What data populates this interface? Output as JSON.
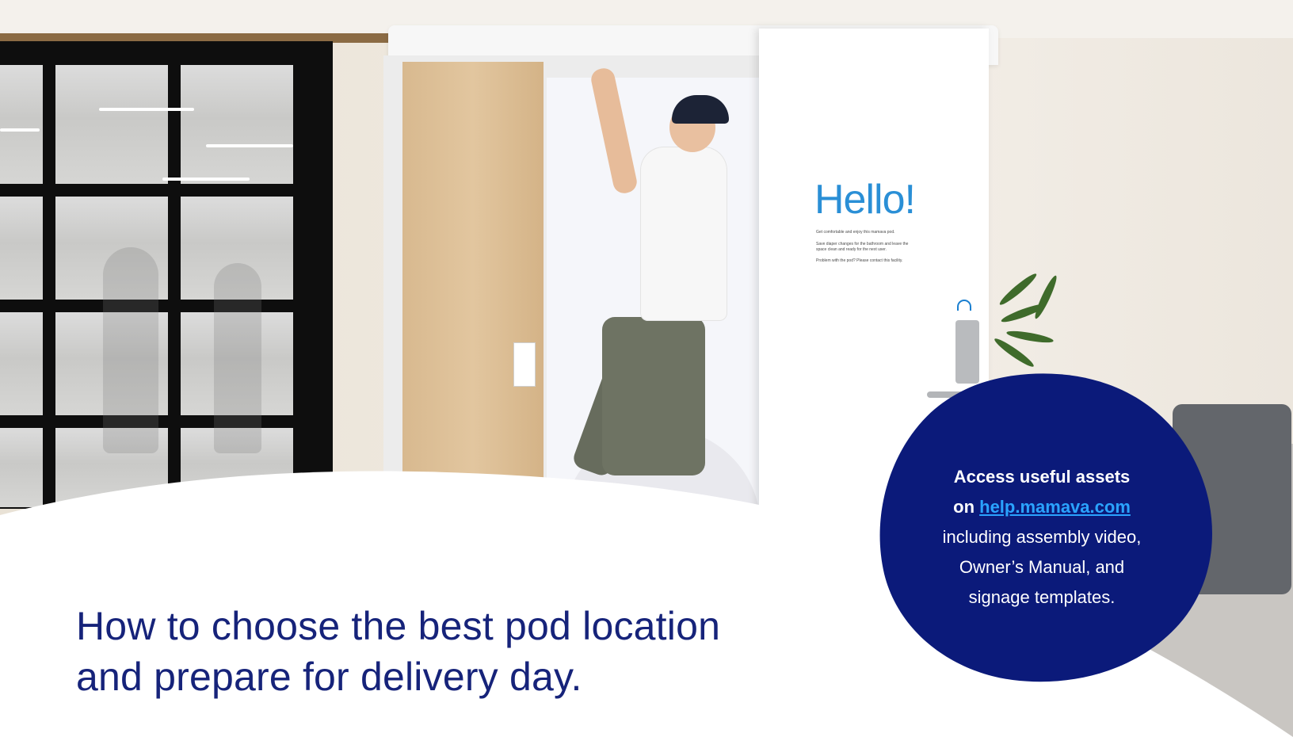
{
  "photo": {
    "alt_subject": "person assembling a mamava pod",
    "door_sign": {
      "greeting": "Hello!",
      "lines": [
        "Get comfortable and enjoy this mamava pod.",
        "Save diaper changes for the bathroom and leave the space clean and ready for the next user.",
        "Problem with the pod? Please contact this facility."
      ]
    }
  },
  "headline": {
    "line1": "How to choose the best pod location",
    "line2": "and prepare for delivery day."
  },
  "callout": {
    "bold_prefix_line1": "Access useful assets",
    "bold_prefix_line2": "on ",
    "link_text": "help.mamava.com",
    "line3": "including assembly video,",
    "line4": "Owner’s Manual, and",
    "line5": "signage templates."
  },
  "colors": {
    "navy": "#0b1a7a",
    "headline": "#16237a",
    "link": "#2aa3ff",
    "hello_blue": "#2a8fd6"
  }
}
